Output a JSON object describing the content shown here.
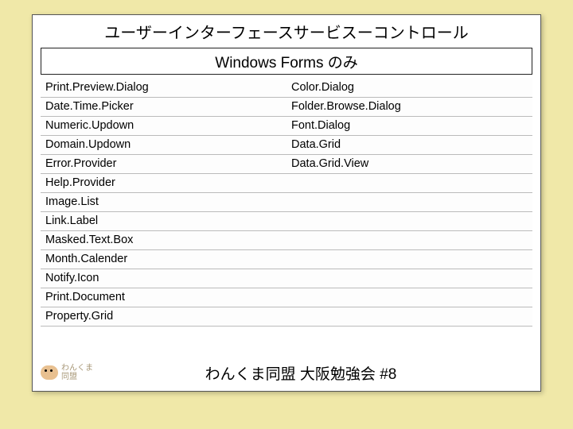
{
  "title": "ユーザーインターフェースサービスーコントロール",
  "subtitle": "Windows Forms のみ",
  "rows": [
    {
      "c1": "Print.Preview.Dialog",
      "c2": "Color.Dialog"
    },
    {
      "c1": "Date.Time.Picker",
      "c2": "Folder.Browse.Dialog"
    },
    {
      "c1": "Numeric.Updown",
      "c2": "Font.Dialog"
    },
    {
      "c1": "Domain.Updown",
      "c2": "Data.Grid"
    },
    {
      "c1": "Error.Provider",
      "c2": "Data.Grid.View"
    },
    {
      "c1": "Help.Provider",
      "c2": ""
    },
    {
      "c1": "Image.List",
      "c2": ""
    },
    {
      "c1": "Link.Label",
      "c2": ""
    },
    {
      "c1": "Masked.Text.Box",
      "c2": ""
    },
    {
      "c1": "Month.Calender",
      "c2": ""
    },
    {
      "c1": "Notify.Icon",
      "c2": ""
    },
    {
      "c1": "Print.Document",
      "c2": ""
    },
    {
      "c1": "Property.Grid",
      "c2": ""
    }
  ],
  "logo_text_line1": "わんくま",
  "logo_text_line2": "同盟",
  "footer_title": "わんくま同盟 大阪勉強会 #8"
}
